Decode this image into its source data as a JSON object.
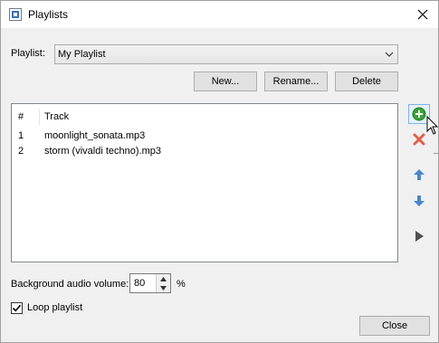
{
  "window": {
    "title": "Playlists"
  },
  "playlist": {
    "label": "Playlist:",
    "selected": "My Playlist"
  },
  "buttons": {
    "new": "New...",
    "rename": "Rename...",
    "delete": "Delete",
    "close": "Close"
  },
  "tracks": {
    "columns": {
      "number": "#",
      "track": "Track"
    },
    "rows": [
      {
        "num": "1",
        "name": "moonlight_sonata.mp3"
      },
      {
        "num": "2",
        "name": "storm (vivaldi techno).mp3"
      }
    ]
  },
  "side_toolbar": [
    {
      "icon": "add-icon",
      "color": "#3aa23a"
    },
    {
      "icon": "remove-icon",
      "color": "#e0604a"
    },
    {
      "icon": "move-up-icon",
      "color": "#4a86c8"
    },
    {
      "icon": "move-down-icon",
      "color": "#4a86c8"
    },
    {
      "icon": "play-icon",
      "color": "#505050"
    }
  ],
  "volume": {
    "label": "Background audio volume:",
    "value": "80",
    "unit": "%"
  },
  "loop": {
    "label": "Loop playlist",
    "checked": true
  }
}
